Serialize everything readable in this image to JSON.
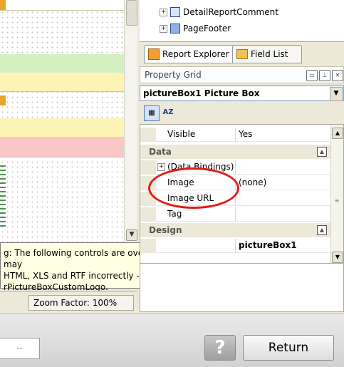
{
  "report_tree": {
    "items": [
      {
        "label": "DetailReportComment",
        "icon": "band-icon"
      },
      {
        "label": "PageFooter",
        "icon": "band-icon"
      }
    ]
  },
  "tabs": [
    {
      "label": "Report Explorer",
      "icon": "report-explorer-icon",
      "active": true
    },
    {
      "label": "Field List",
      "icon": "field-list-icon",
      "active": false
    }
  ],
  "property_grid": {
    "title": "Property Grid",
    "selected_object": "pictureBox1  Picture Box",
    "rows": [
      {
        "kind": "prop",
        "name": "Visible",
        "value": "Yes"
      },
      {
        "kind": "cat",
        "name": "Data"
      },
      {
        "kind": "prop",
        "name": "(Data Bindings)",
        "value": ""
      },
      {
        "kind": "prop",
        "name": "Image",
        "value": "(none)"
      },
      {
        "kind": "prop",
        "name": "Image URL",
        "value": ""
      },
      {
        "kind": "prop",
        "name": "Tag",
        "value": ""
      },
      {
        "kind": "cat",
        "name": "Design"
      },
      {
        "kind": "prop",
        "name": "",
        "value": "pictureBox1"
      }
    ]
  },
  "warning": {
    "lines": [
      "g: The following controls are overlapped and may",
      "HTML, XLS and RTF incorrectly -",
      "rPictureBoxCustomLogo."
    ]
  },
  "status": {
    "zoom": "Zoom Factor: 100%"
  },
  "bottom": {
    "field_value": "--",
    "help_label": "?",
    "return_label": "Return"
  },
  "colors": {
    "highlight_circle": "#e31a1a",
    "band_green": "#d5f0c0",
    "band_yellow": "#fdf3b4",
    "band_pink": "#f9c7c7"
  }
}
